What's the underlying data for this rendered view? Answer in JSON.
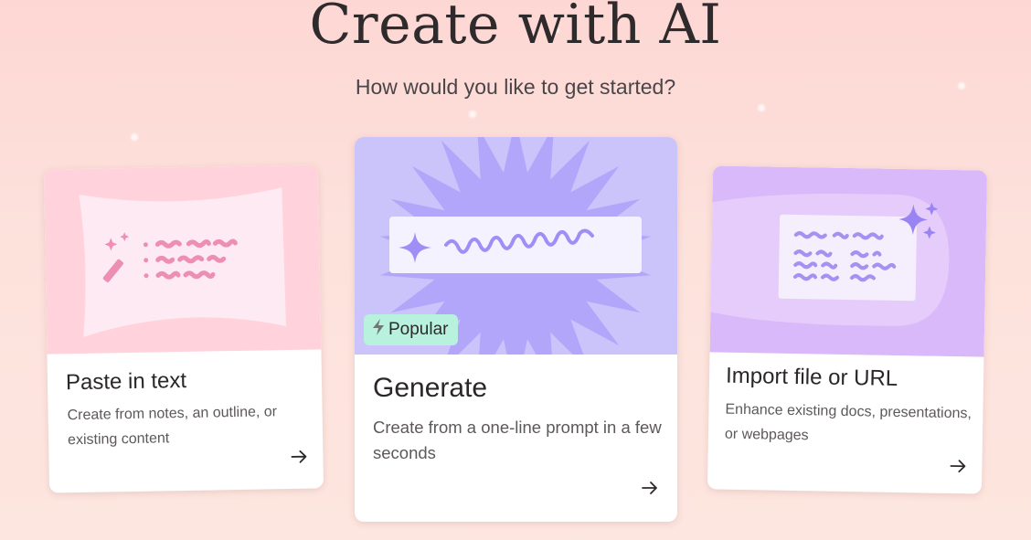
{
  "heading": {
    "title": "Create with AI",
    "subtitle": "How would you like to get started?"
  },
  "cards": [
    {
      "id": "paste",
      "title": "Paste in text",
      "description": "Create from notes, an outline, or existing content",
      "icon": "wand-sparkle-icon",
      "art_color": "#ffd2dc"
    },
    {
      "id": "generate",
      "title": "Generate",
      "description": "Create from a one-line prompt in a few seconds",
      "badge": "Popular",
      "badge_icon": "lightning-icon",
      "badge_color": "#b9f1df",
      "art_color": "#cbc4fb"
    },
    {
      "id": "import",
      "title": "Import file or URL",
      "description": "Enhance existing docs, presentations, or webpages",
      "icon": "sparkles-icon",
      "art_color": "#d9b9f9"
    }
  ],
  "icons": {
    "arrow": "arrow-right-icon"
  }
}
